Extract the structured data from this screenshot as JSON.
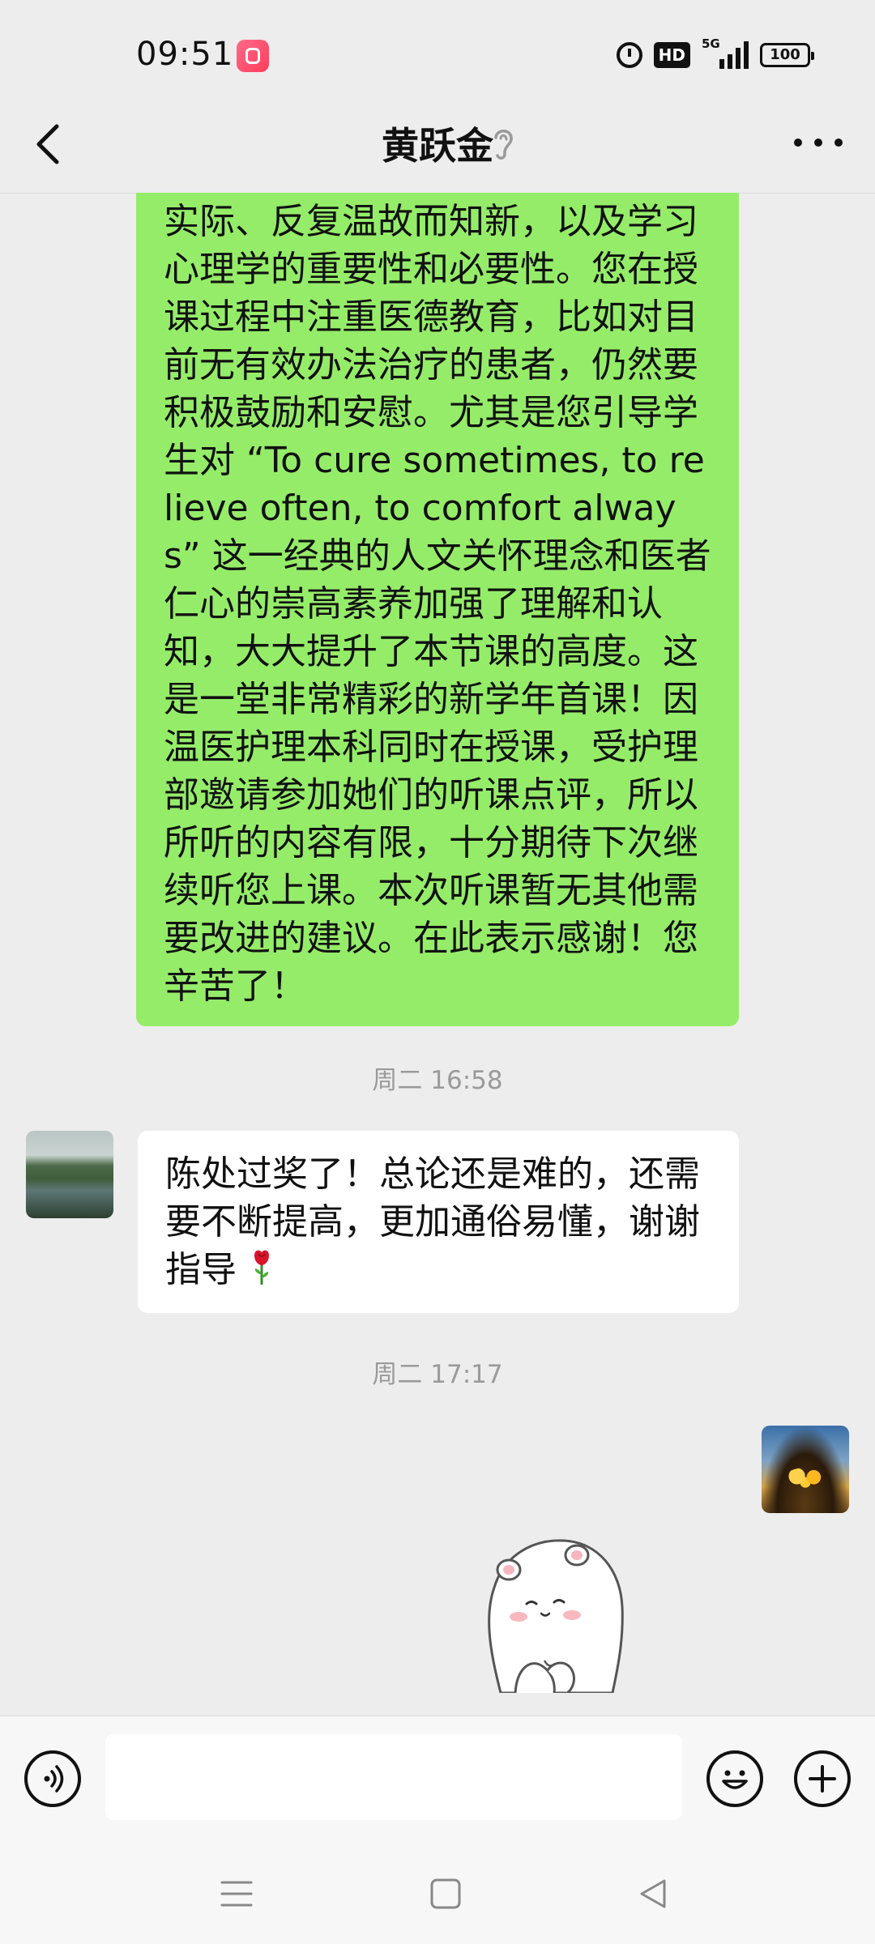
{
  "status_bar": {
    "time": "09:51",
    "app_icon": "kuaishou-app-icon",
    "hd_label": "HD",
    "network_label": "5G",
    "battery_level": "100",
    "icons": [
      "alarm-icon",
      "hd-icon",
      "signal-5g-icon",
      "battery-icon"
    ]
  },
  "header": {
    "title": "黄跃金",
    "back_icon": "chevron-left-icon",
    "earpiece_icon": "ear-icon",
    "more_icon": "more-dots-icon"
  },
  "messages": [
    {
      "side": "right",
      "type": "text",
      "text": "实际、反复温故而知新，以及学习心理学的重要性和必要性。您在授课过程中注重医德教育，比如对目前无有效办法治疗的患者，仍然要积极鼓励和安慰。尤其是您引导学生对 “To cure sometimes, to relieve often, to comfort always” 这一经典的人文关怀理念和医者仁心的崇高素养加强了理解和认知，大大提升了本节课的高度。这是一堂非常精彩的新学年首课！因温医护理本科同时在授课，受护理部邀请参加她们的听课点评，所以所听的内容有限，十分期待下次继续听您上课。本次听课暂无其他需要改进的建议。在此表示感谢！您辛苦了！"
    },
    {
      "type": "timestamp",
      "text": "周二 16:58"
    },
    {
      "side": "left",
      "type": "text",
      "text": "陈处过奖了！总论还是难的，还需要不断提高，更加通俗易懂，谢谢指导",
      "emoji": "rose-emoji"
    },
    {
      "type": "timestamp",
      "text": "周二 17:17"
    },
    {
      "side": "right",
      "type": "sticker",
      "sticker": "white-bear-sticker"
    }
  ],
  "input_bar": {
    "voice_icon": "voice-icon",
    "emoji_icon": "emoji-icon",
    "plus_icon": "plus-icon",
    "input_value": ""
  },
  "system_nav": [
    "menu-icon",
    "home-square-icon",
    "back-triangle-icon"
  ],
  "colors": {
    "background": "#ededed",
    "sent_bubble": "#95ec69",
    "received_bubble": "#ffffff",
    "timestamp_text": "#9a9a9a"
  }
}
